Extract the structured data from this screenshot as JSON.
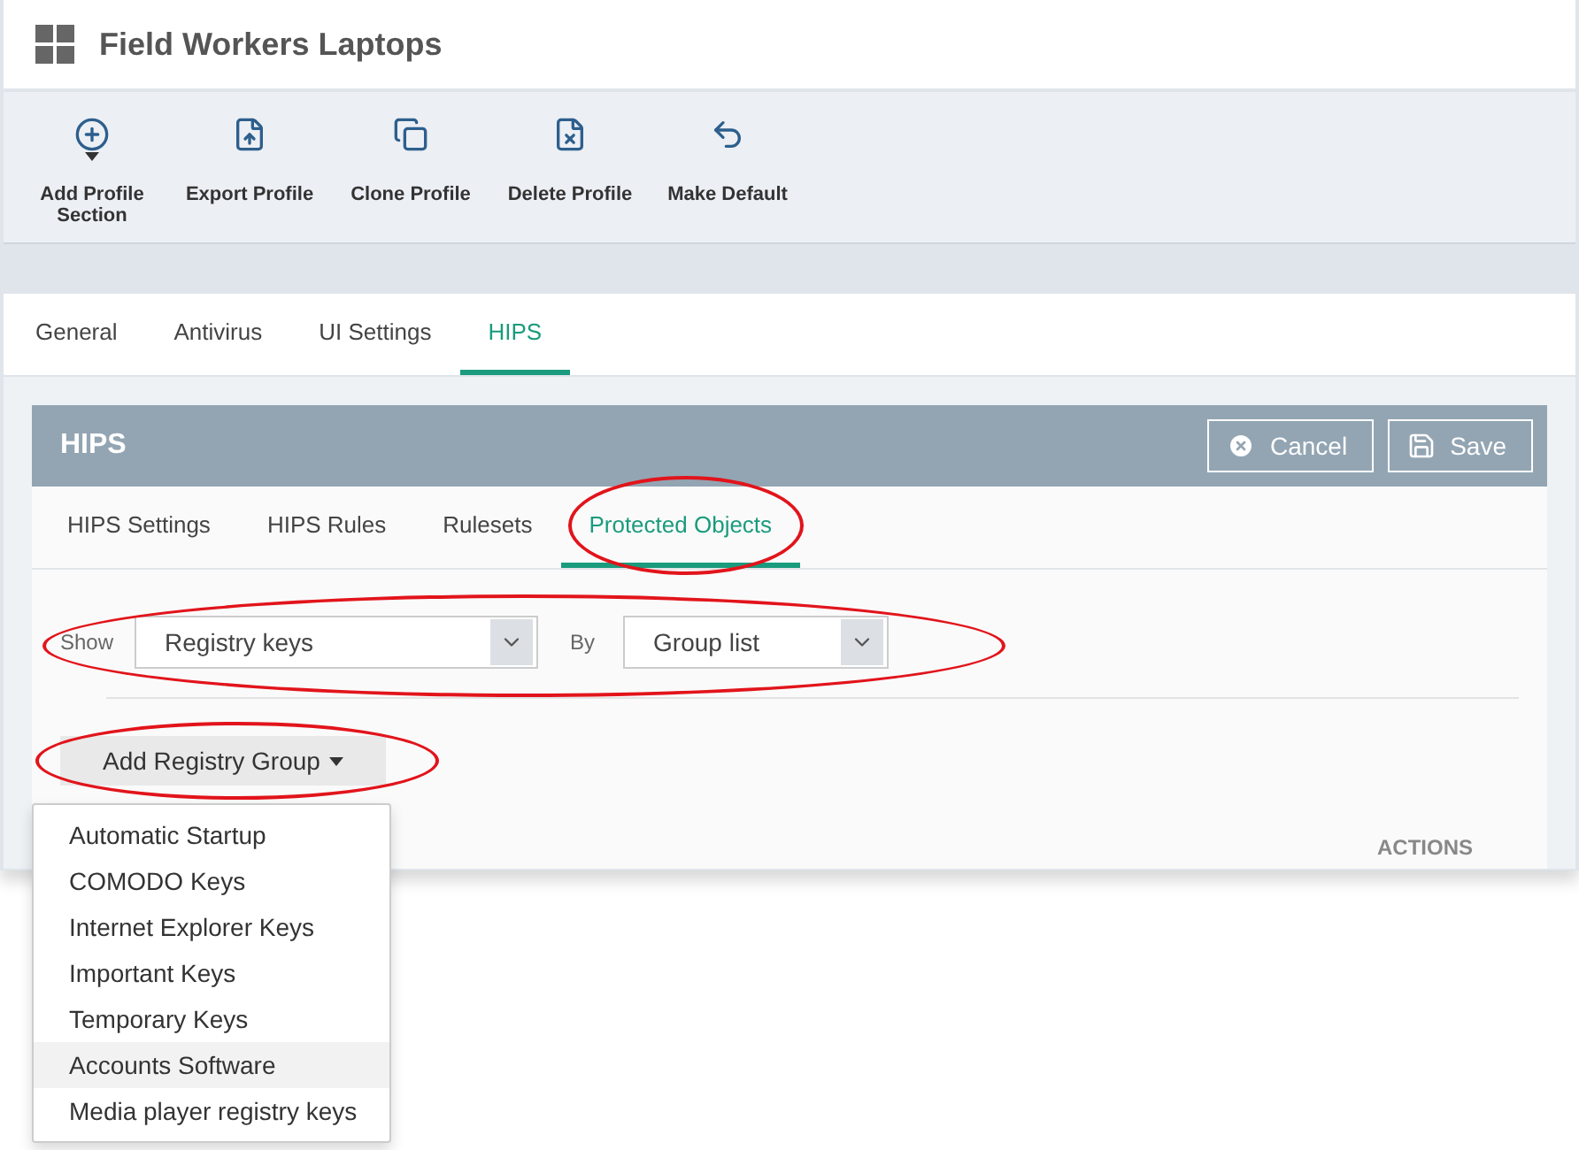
{
  "window": {
    "title": "Field Workers Laptops"
  },
  "toolbar": [
    {
      "label": "Add Profile Section",
      "has_menu": true
    },
    {
      "label": "Export Profile",
      "has_menu": false
    },
    {
      "label": "Clone Profile",
      "has_menu": false
    },
    {
      "label": "Delete Profile",
      "has_menu": false
    },
    {
      "label": "Make Default",
      "has_menu": false
    }
  ],
  "tabs": [
    {
      "label": "General",
      "selected": false
    },
    {
      "label": "Antivirus",
      "selected": false
    },
    {
      "label": "UI Settings",
      "selected": false
    },
    {
      "label": "HIPS",
      "selected": true
    }
  ],
  "panel": {
    "title": "HIPS",
    "buttons": [
      {
        "kind": "cancel",
        "label": "Cancel"
      },
      {
        "kind": "save",
        "label": "Save"
      }
    ],
    "subtabs": [
      {
        "label": "HIPS Settings",
        "selected": false,
        "circled": false
      },
      {
        "label": "HIPS Rules",
        "selected": false,
        "circled": false
      },
      {
        "label": "Rulesets",
        "selected": false,
        "circled": false
      },
      {
        "label": "Protected Objects",
        "selected": true,
        "circled": true
      }
    ],
    "filters": {
      "circled": true,
      "show_label": "Show",
      "show_value": "Registry keys",
      "by_label": "By",
      "by_value": "Group list"
    },
    "add_button": {
      "label": "Add Registry Group",
      "circled": true
    },
    "table": {
      "columns": [
        "ACTIONS"
      ]
    }
  },
  "menu": [
    {
      "label": "Automatic Startup",
      "selected": false
    },
    {
      "label": "COMODO Keys",
      "selected": false
    },
    {
      "label": "Internet Explorer Keys",
      "selected": false
    },
    {
      "label": "Important Keys",
      "selected": false
    },
    {
      "label": "Temporary Keys",
      "selected": false
    },
    {
      "label": "Accounts Software",
      "selected": true
    },
    {
      "label": "Media player registry keys",
      "selected": false
    }
  ]
}
